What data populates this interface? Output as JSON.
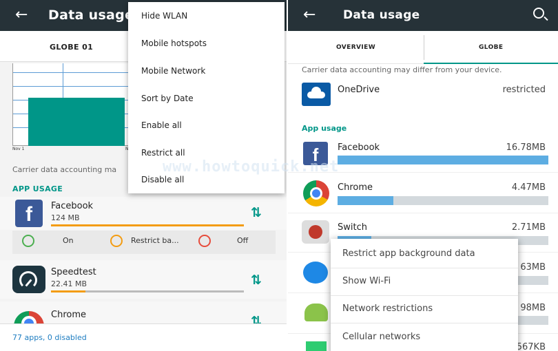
{
  "left": {
    "title": "Data usage",
    "tab": "GLOBE 01",
    "chart": {
      "x_start": "Nov 1",
      "x_mid": "N"
    },
    "carrier_text": "Carrier data accounting ma",
    "app_usage_label": "APP USAGE",
    "apps": [
      {
        "name": "Facebook",
        "size": "124 MB",
        "icon": "facebook-icon",
        "fraction": 1.0
      },
      {
        "name": "Speedtest",
        "size": "22.41 MB",
        "icon": "speedometer-icon",
        "fraction": 0.18
      },
      {
        "name": "Chrome",
        "size": "",
        "icon": "chrome-icon"
      }
    ],
    "options": {
      "on": "On",
      "restrict": "Restrict ba...",
      "off": "Off"
    },
    "footer": "77 apps, 0 disabled",
    "menu": [
      "Hide WLAN",
      "Mobile hotspots",
      "Mobile Network",
      "Sort by Date",
      "Enable all",
      "Restrict all",
      "Disable all"
    ]
  },
  "right": {
    "title": "Data usage",
    "tabs": [
      "OVERVIEW",
      "GLOBE"
    ],
    "carrier_text": "Carrier data accounting may differ from your device.",
    "restricted_app": {
      "name": "OneDrive",
      "status": "restricted"
    },
    "app_usage_label": "App usage",
    "apps": [
      {
        "name": "Facebook",
        "size": "16.78MB",
        "fraction": 1.0
      },
      {
        "name": "Chrome",
        "size": "4.47MB",
        "fraction": 0.266
      },
      {
        "name": "Switch",
        "size": "2.71MB",
        "fraction": 0.16
      },
      {
        "name": "",
        "size": "63MB",
        "fraction": 0.1
      },
      {
        "name": "",
        "size": "98MB",
        "fraction": 0.06
      },
      {
        "name": "",
        "size": "567KB",
        "fraction": 0.03
      }
    ],
    "menu": [
      "Restrict app background data",
      "Show Wi-Fi",
      "Network restrictions",
      "Cellular networks"
    ]
  },
  "watermark": "www.howtoquick.net"
}
